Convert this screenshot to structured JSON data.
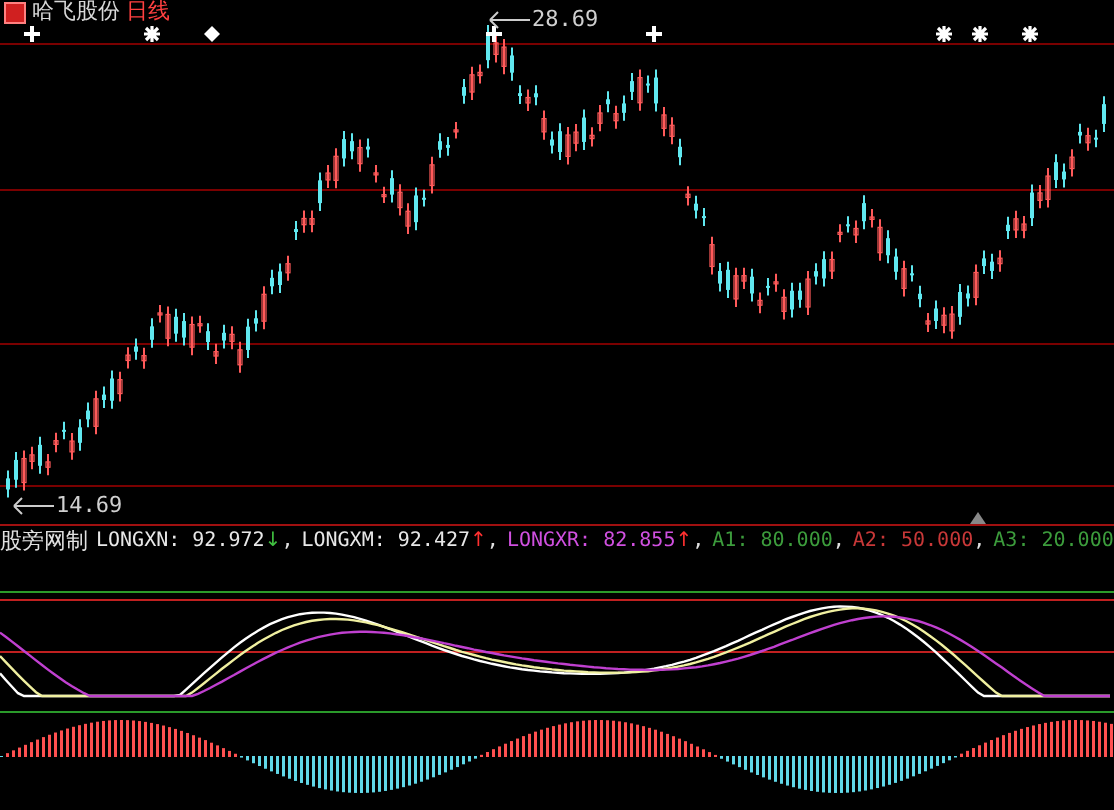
{
  "header": {
    "stock_name": "哈飞股份",
    "period": "日线"
  },
  "price_labels": [
    {
      "kind": "high",
      "text": "28.69"
    },
    {
      "kind": "low",
      "text": "14.69"
    }
  ],
  "indicator": {
    "name": "股旁网制",
    "items": [
      {
        "label": "LONGXN: 92.972",
        "arrow": {
          "text": "↓",
          "color": "#40c040"
        },
        "separator": ",",
        "color": "#e8e8e8"
      },
      {
        "label": "LONGXM: 92.427",
        "arrow": {
          "text": "↑",
          "color": "#ff3030"
        },
        "separator": ",",
        "color": "#e8e8e8"
      },
      {
        "label": "LONGXR: 82.855",
        "arrow": {
          "text": "↑",
          "color": "#ff3030"
        },
        "separator": ",",
        "color": "#d050e0"
      },
      {
        "label": "A1: 80.000",
        "separator": ",",
        "color": "#3c9c3c"
      },
      {
        "label": "A2: 50.000",
        "separator": ",",
        "color": "#c83838"
      },
      {
        "label": "A3: 20.000",
        "color": "#3c9c3c"
      }
    ]
  }
}
